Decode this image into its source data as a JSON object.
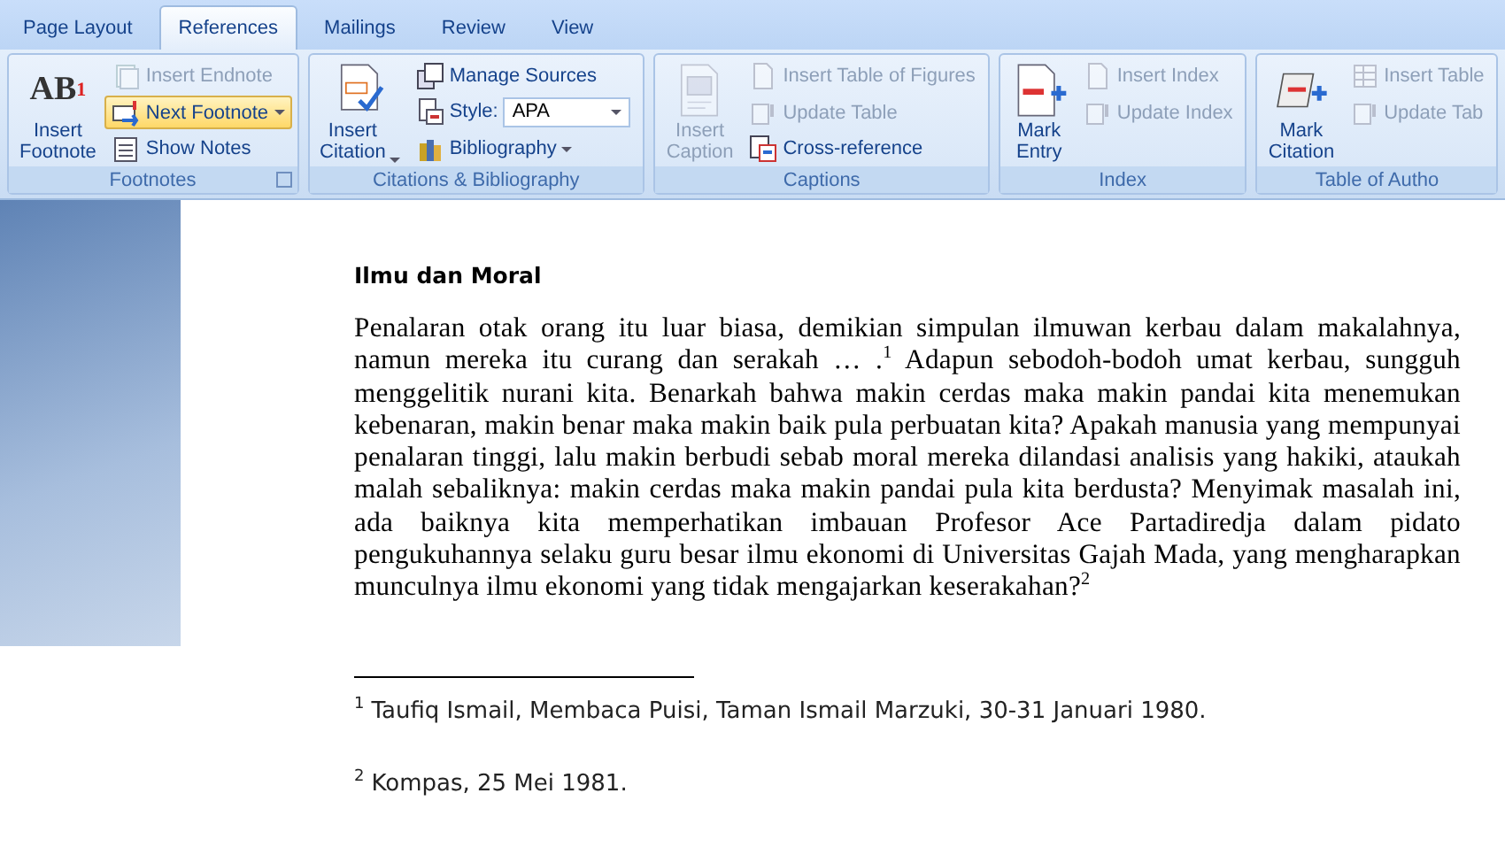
{
  "tabs": [
    {
      "label": "Page Layout",
      "selected": false
    },
    {
      "label": "References",
      "selected": true
    },
    {
      "label": "Mailings",
      "selected": false
    },
    {
      "label": "Review",
      "selected": false
    },
    {
      "label": "View",
      "selected": false
    }
  ],
  "ribbon": {
    "groups": [
      {
        "label": "Footnotes",
        "launcher": true,
        "large": {
          "label": "Insert Footnote",
          "glyph": "AB",
          "glyph_mark": "1",
          "disabled": false,
          "dropdown": false
        },
        "items": [
          {
            "kind": "button",
            "label": "Insert Endnote",
            "disabled": true,
            "highlighted": false,
            "dropdown": false
          },
          {
            "kind": "button",
            "label": "Next Footnote",
            "disabled": false,
            "highlighted": true,
            "dropdown": true
          },
          {
            "kind": "button",
            "label": "Show Notes",
            "disabled": false,
            "highlighted": false,
            "dropdown": false
          }
        ]
      },
      {
        "label": "Citations & Bibliography",
        "launcher": false,
        "large": {
          "label": "Insert Citation",
          "disabled": false,
          "dropdown": true
        },
        "items": [
          {
            "kind": "button",
            "label": "Manage Sources",
            "disabled": false,
            "highlighted": false,
            "dropdown": false
          },
          {
            "kind": "combo",
            "label": "Style:",
            "value": "APA",
            "disabled": false,
            "highlighted": false,
            "dropdown": true
          },
          {
            "kind": "button",
            "label": "Bibliography",
            "disabled": false,
            "highlighted": false,
            "dropdown": true
          }
        ]
      },
      {
        "label": "Captions",
        "launcher": false,
        "large": {
          "label": "Insert Caption",
          "disabled": true,
          "dropdown": false
        },
        "items": [
          {
            "kind": "button",
            "label": "Insert Table of Figures",
            "disabled": true,
            "highlighted": false,
            "dropdown": false
          },
          {
            "kind": "button",
            "label": "Update Table",
            "disabled": true,
            "highlighted": false,
            "dropdown": false
          },
          {
            "kind": "button",
            "label": "Cross-reference",
            "disabled": false,
            "highlighted": false,
            "dropdown": false
          }
        ]
      },
      {
        "label": "Index",
        "launcher": false,
        "large": {
          "label": "Mark Entry",
          "disabled": false,
          "dropdown": false
        },
        "items": [
          {
            "kind": "button",
            "label": "Insert Index",
            "disabled": true,
            "highlighted": false,
            "dropdown": false
          },
          {
            "kind": "button",
            "label": "Update Index",
            "disabled": true,
            "highlighted": false,
            "dropdown": false
          }
        ]
      },
      {
        "label": "Table of Autho",
        "launcher": false,
        "large": {
          "label": "Mark Citation",
          "disabled": false,
          "dropdown": false
        },
        "items": [
          {
            "kind": "button",
            "label": "Insert Table",
            "disabled": true,
            "highlighted": false,
            "dropdown": false
          },
          {
            "kind": "button",
            "label": "Update Tab",
            "disabled": true,
            "highlighted": false,
            "dropdown": false
          }
        ]
      }
    ]
  },
  "document": {
    "heading": "Ilmu dan Moral",
    "paragraph": "Penalaran otak orang itu luar biasa, demikian simpulan ilmuwan kerbau dalam makalahnya, namun mereka itu curang dan serakah … .$^{1}$ Adapun sebodoh-bodoh umat kerbau, sungguh menggelitik nurani kita. Benarkah bahwa makin cerdas maka makin pandai kita menemukan kebenaran, makin benar maka makin baik pula perbuatan kita? Apakah manusia yang mempunyai penalaran tinggi, lalu makin berbudi sebab moral mereka dilandasi analisis yang hakiki, ataukah malah sebaliknya: makin cerdas maka makin pandai pula kita berdusta? Menyimak masalah ini, ada baiknya kita memperhatikan imbauan Profesor Ace Partadiredja dalam pidato pengukuhannya selaku guru besar ilmu ekonomi di Universitas Gajah Mada, yang mengharapkan munculnya ilmu ekonomi yang tidak mengajarkan keserakahan?$^{2}$",
    "footnotes": [
      {
        "mark": "1",
        "text": "Taufiq Ismail, Membaca Puisi, Taman Ismail Marzuki, 30-31 Januari 1980."
      },
      {
        "mark": "2",
        "text": "Kompas, 25 Mei 1981."
      }
    ]
  }
}
